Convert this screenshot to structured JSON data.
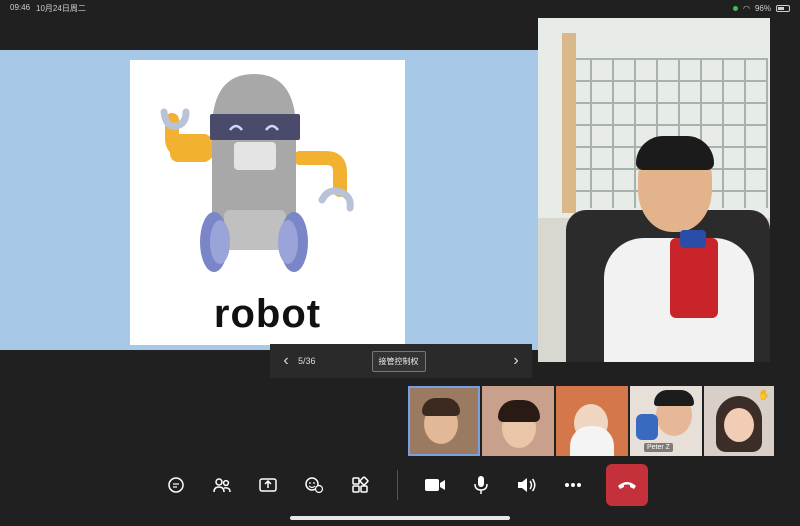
{
  "status": {
    "time": "09:46",
    "date": "10月24日周二",
    "battery": "96%"
  },
  "slide": {
    "word": "robot"
  },
  "slide_nav": {
    "page": "5/36",
    "control_label": "接管控制权"
  },
  "participants": [
    {
      "name": ""
    },
    {
      "name": ""
    },
    {
      "name": ""
    },
    {
      "name": "Peter Z"
    },
    {
      "name": ""
    }
  ],
  "toolbar": {
    "icons": [
      "chat-icon",
      "people-icon",
      "share-icon",
      "reactions-icon",
      "apps-icon",
      "camera-icon",
      "mic-icon",
      "speaker-icon",
      "more-icon",
      "hang-up-icon"
    ]
  },
  "colors": {
    "share_bg": "#a8c8e8",
    "end_call": "#c4313a",
    "robot_body": "#a8a8a8",
    "robot_arm": "#f2b130",
    "robot_visor": "#4a4a6a"
  }
}
